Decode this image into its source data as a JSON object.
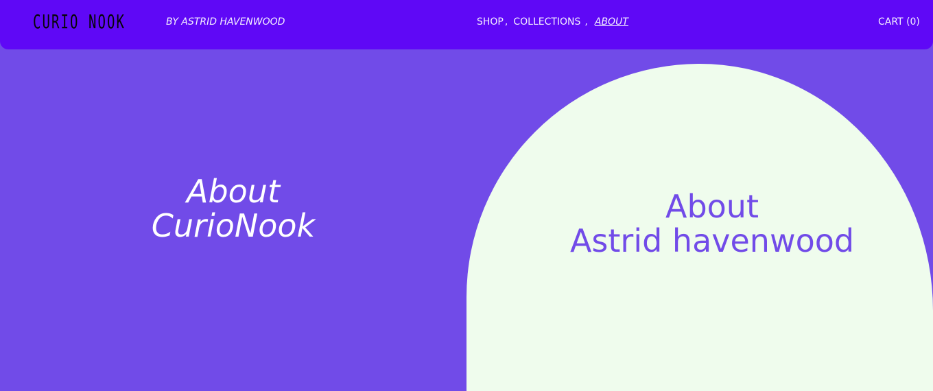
{
  "header": {
    "logo_text": "CURIO NOOK",
    "byline": "BY ASTRID HAVENWOOD",
    "nav": {
      "shop": "SHOP",
      "collections": "COLLECTIONS",
      "about": "ABOUT",
      "separator": ","
    },
    "cart_label": "CART (0)"
  },
  "main": {
    "left_title_line1": "About",
    "left_title_line2": "CurioNook",
    "right_title_line1": "About",
    "right_title_line2": "Astrid havenwood"
  },
  "colors": {
    "header_bg": "#5f08f6",
    "page_bg": "#714be8",
    "arch_bg": "#effced",
    "accent_text": "#714be8"
  }
}
